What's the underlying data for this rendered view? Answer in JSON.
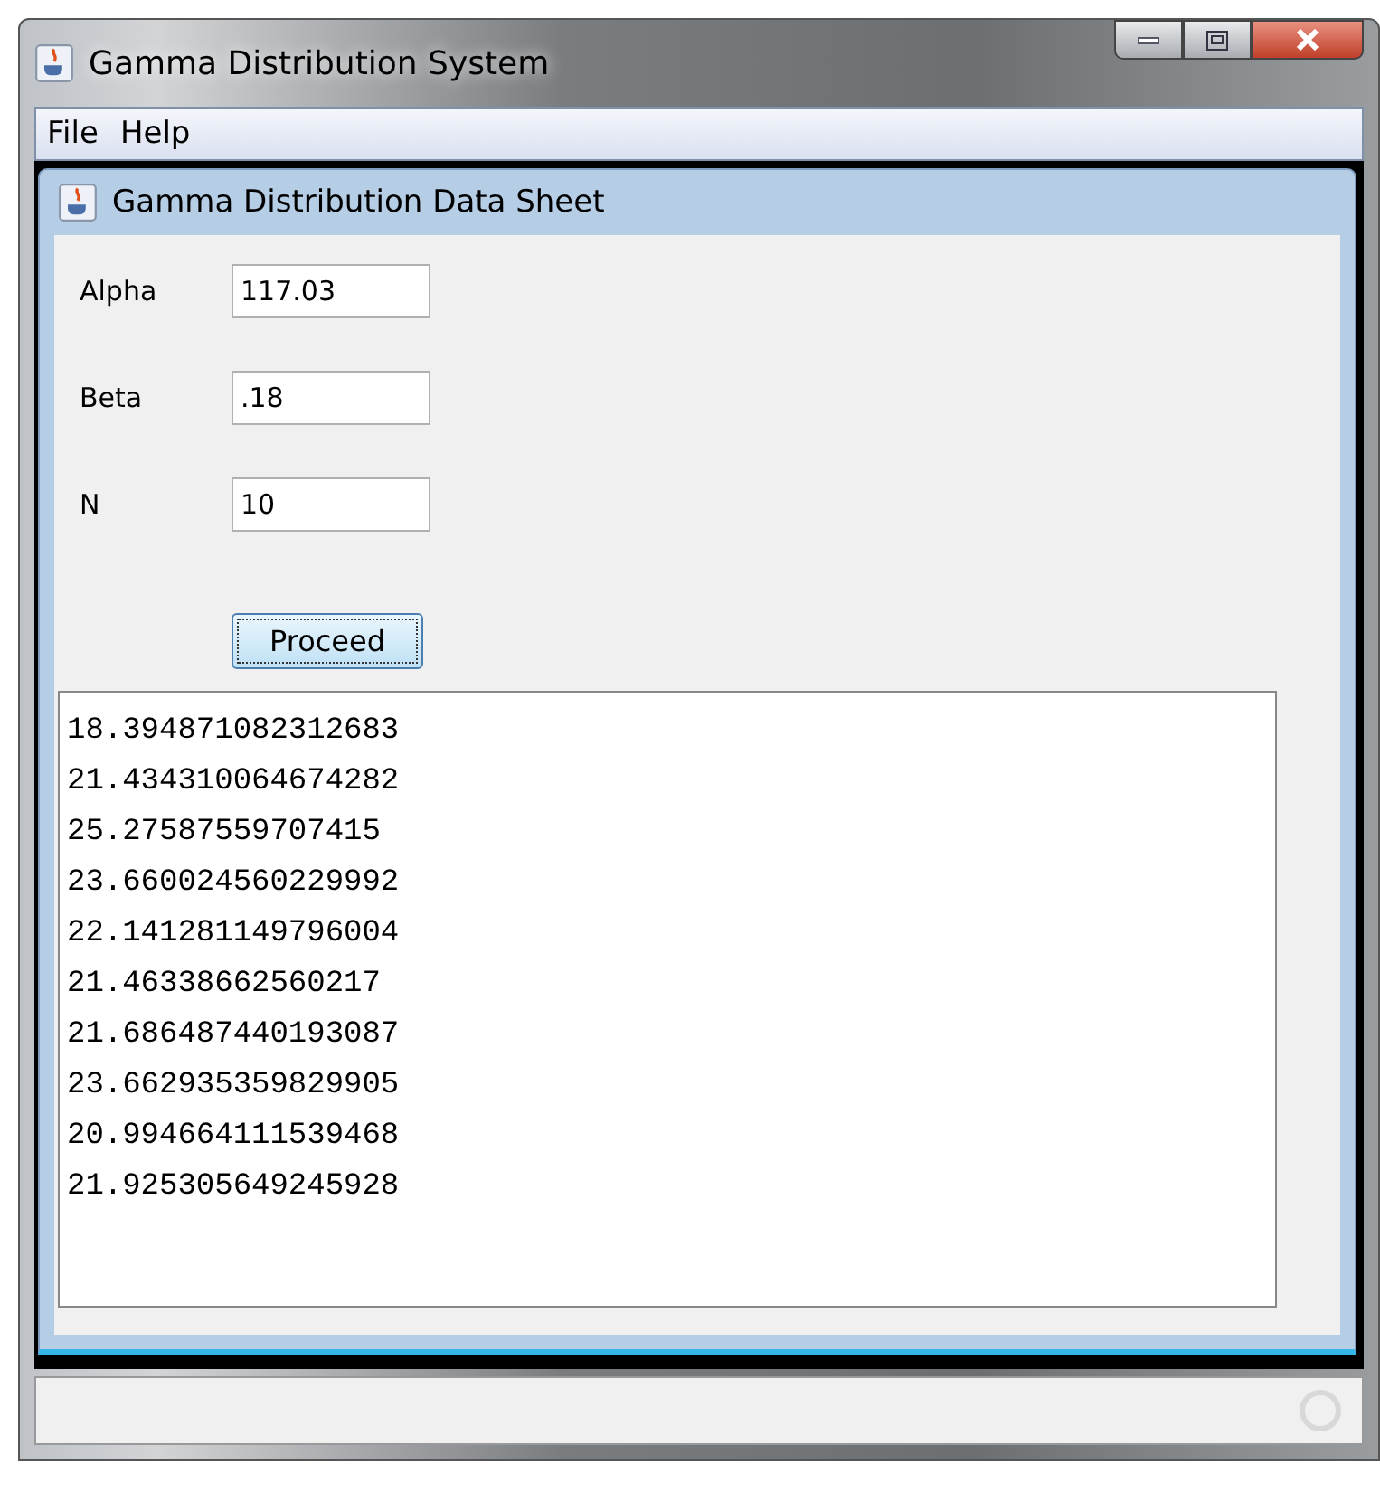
{
  "window": {
    "title": "Gamma Distribution System"
  },
  "menu": [
    "File",
    "Help"
  ],
  "inner_window": {
    "title": "Gamma Distribution Data Sheet"
  },
  "fields": [
    {
      "label": "Alpha",
      "value": "117.03"
    },
    {
      "label": "Beta",
      "value": ".18"
    },
    {
      "label": "N",
      "value": "10"
    }
  ],
  "button": {
    "label": "Proceed"
  },
  "output_lines": [
    "18.394871082312683",
    "21.434310064674282",
    "25.27587559707415",
    "23.660024560229992",
    "22.141281149796004",
    "21.46338662560217",
    "21.686487440193087",
    "23.662935359829905",
    "20.994664111539468",
    "21.925305649245928"
  ]
}
